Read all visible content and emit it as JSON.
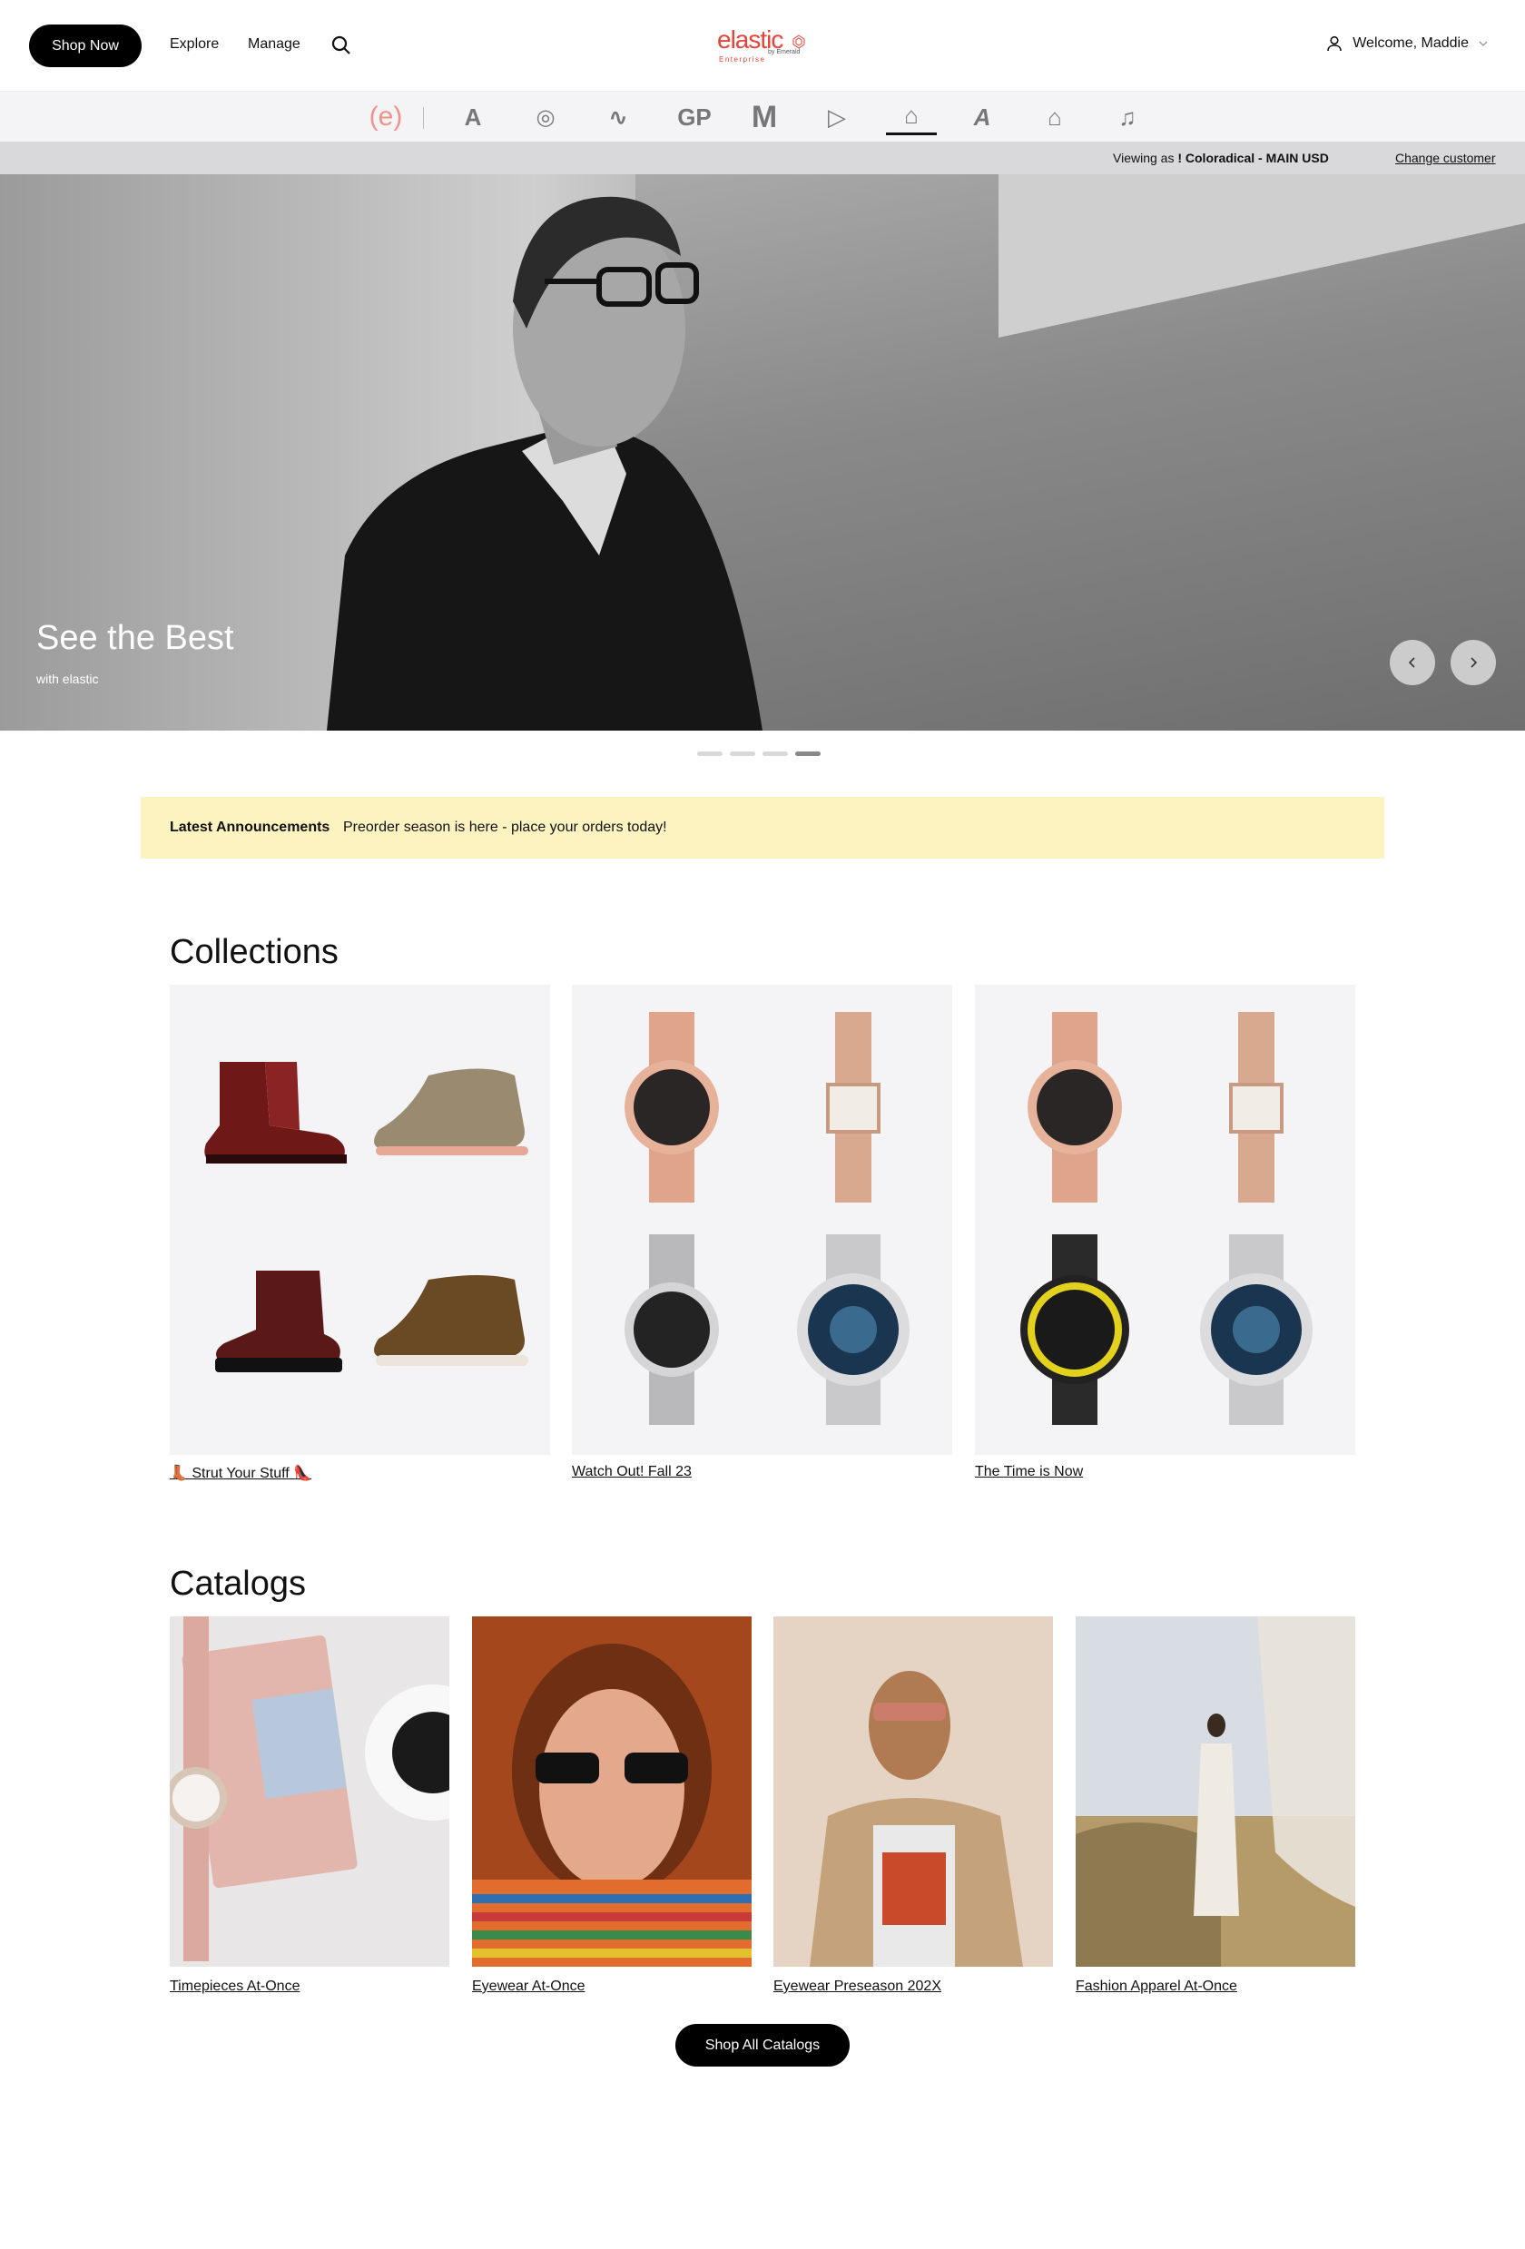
{
  "header": {
    "shop_now": "Shop Now",
    "explore": "Explore",
    "manage": "Manage",
    "logo_text": "elastic",
    "logo_by": "by Emerald",
    "logo_sub": "Enterprise",
    "welcome": "Welcome, Maddie"
  },
  "brands": [
    {
      "label": "(e)"
    },
    {
      "label": "A"
    },
    {
      "label": "◎"
    },
    {
      "label": "∿"
    },
    {
      "label": "GP"
    },
    {
      "label": "M"
    },
    {
      "label": "▷"
    },
    {
      "label": "⌂"
    },
    {
      "label": "A"
    },
    {
      "label": "⌂"
    },
    {
      "label": "♫"
    }
  ],
  "viewing": {
    "prefix": "Viewing as",
    "customer": "! Coloradical - MAIN USD",
    "change": "Change customer"
  },
  "hero": {
    "title": "See the Best",
    "subtitle": "with elastic",
    "prev_icon": "chevron-left-icon",
    "next_icon": "chevron-right-icon"
  },
  "announcement": {
    "label": "Latest Announcements",
    "text": "Preorder season is here - place your orders today!"
  },
  "collections": {
    "title": "Collections",
    "items": [
      {
        "label": "👢 Strut Your Stuff 👠"
      },
      {
        "label": "Watch Out! Fall 23"
      },
      {
        "label": "The Time is Now"
      }
    ]
  },
  "catalogs": {
    "title": "Catalogs",
    "items": [
      {
        "label": "Timepieces At-Once"
      },
      {
        "label": "Eyewear At-Once"
      },
      {
        "label": "Eyewear Preseason 202X"
      },
      {
        "label": "Fashion Apparel At-Once"
      }
    ],
    "shop_all": "Shop All Catalogs"
  },
  "colors": {
    "brand_red": "#e4453b",
    "announce_bg": "#fdf3c0",
    "card_bg": "#f4f4f6",
    "button_bg": "#000000"
  }
}
